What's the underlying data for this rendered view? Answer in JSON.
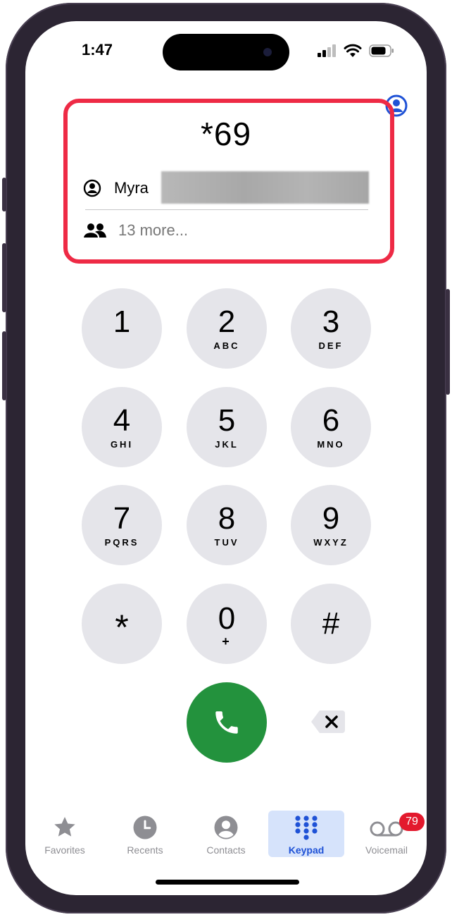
{
  "status_bar": {
    "time": "1:47"
  },
  "dialer": {
    "number": "*69"
  },
  "suggestion": {
    "name": "Myra",
    "more": "13 more..."
  },
  "keys": [
    {
      "digit": "1",
      "letters": ""
    },
    {
      "digit": "2",
      "letters": "ABC"
    },
    {
      "digit": "3",
      "letters": "DEF"
    },
    {
      "digit": "4",
      "letters": "GHI"
    },
    {
      "digit": "5",
      "letters": "JKL"
    },
    {
      "digit": "6",
      "letters": "MNO"
    },
    {
      "digit": "7",
      "letters": "PQRS"
    },
    {
      "digit": "8",
      "letters": "TUV"
    },
    {
      "digit": "9",
      "letters": "WXYZ"
    },
    {
      "digit": "*",
      "letters": ""
    },
    {
      "digit": "0",
      "letters": "+"
    },
    {
      "digit": "#",
      "letters": ""
    }
  ],
  "tabs": [
    {
      "label": "Favorites",
      "icon": "star-icon"
    },
    {
      "label": "Recents",
      "icon": "clock-icon"
    },
    {
      "label": "Contacts",
      "icon": "person-circle-icon"
    },
    {
      "label": "Keypad",
      "icon": "keypad-icon",
      "active": true
    },
    {
      "label": "Voicemail",
      "icon": "voicemail-icon",
      "badge": "79"
    }
  ],
  "colors": {
    "call": "#23923d",
    "highlight": "#ee2a45",
    "accent": "#1f52d6",
    "badge": "#e3192d"
  }
}
